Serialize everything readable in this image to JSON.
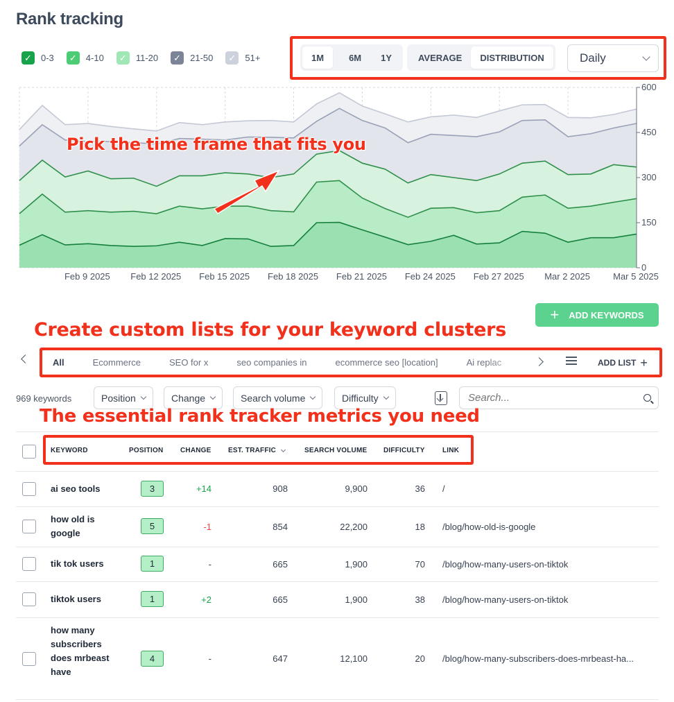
{
  "page": {
    "title": "Rank tracking"
  },
  "legend": [
    {
      "label": "0-3",
      "color": "#16a34a"
    },
    {
      "label": "4-10",
      "color": "#4ccd75"
    },
    {
      "label": "11-20",
      "color": "#9fe7b4"
    },
    {
      "label": "21-50",
      "color": "#7c8497"
    },
    {
      "label": "51+",
      "color": "#cdd1db"
    }
  ],
  "controls": {
    "periods": [
      "1M",
      "6M",
      "1Y"
    ],
    "active_period": "1M",
    "modes": [
      "AVERAGE",
      "DISTRIBUTION"
    ],
    "active_mode": "DISTRIBUTION",
    "interval": "Daily"
  },
  "chart_data": {
    "type": "area",
    "stacked": true,
    "x": [
      "Feb 6 2025",
      "Feb 7 2025",
      "Feb 8 2025",
      "Feb 9 2025",
      "Feb 10 2025",
      "Feb 11 2025",
      "Feb 12 2025",
      "Feb 13 2025",
      "Feb 14 2025",
      "Feb 15 2025",
      "Feb 16 2025",
      "Feb 17 2025",
      "Feb 18 2025",
      "Feb 19 2025",
      "Feb 20 2025",
      "Feb 21 2025",
      "Feb 22 2025",
      "Feb 23 2025",
      "Feb 24 2025",
      "Feb 25 2025",
      "Feb 26 2025",
      "Feb 27 2025",
      "Feb 28 2025",
      "Mar 1 2025",
      "Mar 2 2025",
      "Mar 3 2025",
      "Mar 4 2025",
      "Mar 5 2025"
    ],
    "xticks": [
      "Feb 9 2025",
      "Feb 12 2025",
      "Feb 15 2025",
      "Feb 18 2025",
      "Feb 21 2025",
      "Feb 24 2025",
      "Feb 27 2025",
      "Mar 2 2025",
      "Mar 5 2025"
    ],
    "ylim": [
      0,
      600
    ],
    "yticks": [
      0,
      150,
      300,
      450,
      600
    ],
    "grid": true,
    "series": [
      {
        "name": "0-3",
        "color": "#15803d",
        "fill": "#9be0b0",
        "values": [
          75,
          110,
          76,
          80,
          74,
          71,
          73,
          85,
          74,
          97,
          96,
          71,
          74,
          150,
          151,
          126,
          102,
          77,
          88,
          108,
          79,
          83,
          121,
          115,
          85,
          100,
          100,
          112
        ]
      },
      {
        "name": "4-10",
        "color": "#2f8f4a",
        "fill": "#b8ecc6",
        "values": [
          180,
          245,
          185,
          190,
          185,
          188,
          180,
          205,
          196,
          205,
          205,
          190,
          186,
          285,
          290,
          232,
          197,
          168,
          198,
          200,
          183,
          190,
          235,
          242,
          198,
          205,
          218,
          230
        ]
      },
      {
        "name": "11-20",
        "color": "#2f8f4a",
        "fill": "#d7f3df",
        "values": [
          290,
          358,
          302,
          322,
          296,
          298,
          271,
          306,
          306,
          316,
          312,
          300,
          312,
          378,
          390,
          348,
          328,
          282,
          310,
          300,
          290,
          312,
          348,
          355,
          310,
          312,
          343,
          335
        ]
      },
      {
        "name": "21-50",
        "color": "#9aa1b6",
        "fill": "#e3e5ec",
        "values": [
          405,
          476,
          425,
          420,
          420,
          416,
          412,
          430,
          428,
          425,
          435,
          434,
          432,
          487,
          530,
          490,
          465,
          416,
          444,
          440,
          436,
          452,
          490,
          492,
          436,
          446,
          465,
          480
        ]
      },
      {
        "name": "51+",
        "color": "#c4c8d4",
        "fill": "#eef0f4",
        "values": [
          460,
          540,
          476,
          480,
          470,
          462,
          455,
          483,
          476,
          485,
          489,
          490,
          485,
          545,
          582,
          538,
          512,
          485,
          502,
          508,
          500,
          522,
          542,
          543,
          500,
          499,
          510,
          528
        ]
      }
    ]
  },
  "annotations": {
    "time_frame": "Pick the time frame that fits you",
    "custom_lists": "Create custom lists for your keyword clusters",
    "metrics": "The essential rank tracker metrics you need"
  },
  "add_keywords": {
    "label": "ADD KEYWORDS"
  },
  "lists": {
    "tabs": [
      "All",
      "Ecommerce",
      "SEO for x",
      "seo companies in",
      "ecommerce seo [location]",
      "Ai replac"
    ],
    "active": "All",
    "add_list_label": "ADD LIST"
  },
  "filters": {
    "keyword_count": "969 keywords",
    "dropdowns": [
      "Position",
      "Change",
      "Search volume",
      "Difficulty"
    ],
    "search_placeholder": "Search..."
  },
  "table": {
    "columns": [
      "KEYWORD",
      "POSITION",
      "CHANGE",
      "EST. TRAFFIC",
      "SEARCH VOLUME",
      "DIFFICULTY",
      "LINK"
    ],
    "rows": [
      {
        "keyword": "ai seo tools",
        "position": "3",
        "change": "+14",
        "traffic": "908",
        "volume": "9,900",
        "difficulty": "36",
        "link": "/"
      },
      {
        "keyword": "how old is google",
        "position": "5",
        "change": "-1",
        "traffic": "854",
        "volume": "22,200",
        "difficulty": "18",
        "link": "/blog/how-old-is-google"
      },
      {
        "keyword": "tik tok users",
        "position": "1",
        "change": "-",
        "traffic": "665",
        "volume": "1,900",
        "difficulty": "70",
        "link": "/blog/how-many-users-on-tiktok"
      },
      {
        "keyword": "tiktok users",
        "position": "1",
        "change": "+2",
        "traffic": "665",
        "volume": "1,900",
        "difficulty": "38",
        "link": "/blog/how-many-users-on-tiktok"
      },
      {
        "keyword": "how many subscribers does mrbeast have",
        "position": "4",
        "change": "-",
        "traffic": "647",
        "volume": "12,100",
        "difficulty": "20",
        "link": "/blog/how-many-subscribers-does-mrbeast-ha..."
      }
    ]
  },
  "colors": {
    "annotation": "#f2311d",
    "accent": "#5bd38e",
    "positive": "#16a34a",
    "negative": "#ef4444"
  }
}
